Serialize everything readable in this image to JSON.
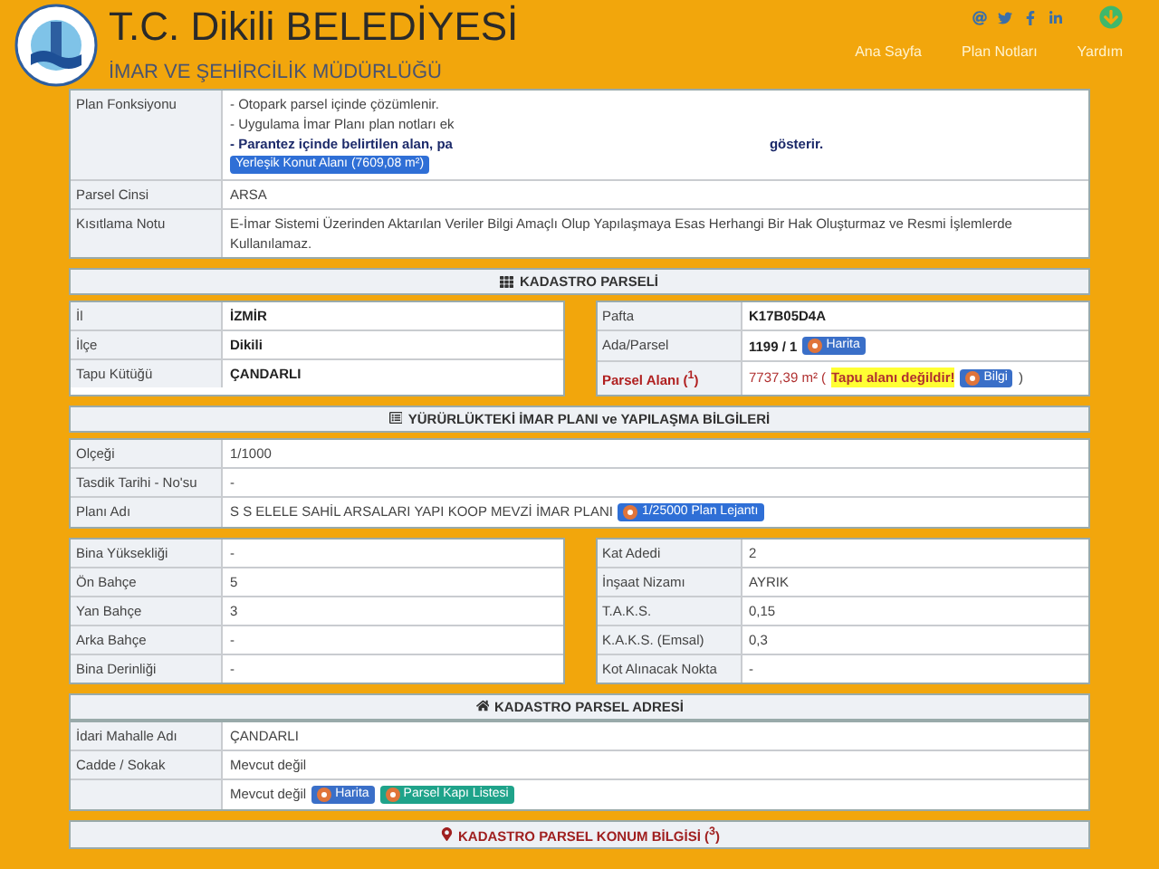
{
  "header": {
    "title": "T.C. Dikili BELEDİYESİ",
    "subtitle": "İMAR VE ŞEHİRCİLİK MÜDÜRLÜĞÜ",
    "nav": [
      "Ana Sayfa",
      "Plan Notları",
      "Yardım"
    ]
  },
  "top_rows": [
    {
      "label": "Plan Fonksiyonu",
      "parts": [
        {
          "kind": "line",
          "text": "- Otopark parsel içinde çözümlenir."
        },
        {
          "kind": "line",
          "text": "- Uygulama İmar Planı plan notları ek"
        },
        {
          "kind": "boldline",
          "text": "- Parantez içinde belirtilen alan, pa",
          "tail": "gösterir."
        },
        {
          "kind": "badge",
          "text": "Yerleşik Konut Alanı (7609,08 m²)",
          "color": "#2f6fd6",
          "icon": false
        }
      ]
    },
    {
      "label": "Parsel Cinsi",
      "parts": [
        {
          "kind": "text",
          "text": "ARSA"
        }
      ]
    },
    {
      "label": "Kısıtlama Notu",
      "parts": [
        {
          "kind": "text",
          "text": "E-İmar Sistemi Üzerinden Aktarılan Veriler Bilgi Amaçlı Olup Yapılaşmaya Esas Herhangi Bir Hak Oluşturmaz ve Resmi İşlemlerde Kullanılamaz."
        }
      ]
    }
  ],
  "kadastro": {
    "title": "KADASTRO PARSELİ",
    "left": [
      {
        "label": "İl",
        "alert": false,
        "parts": [
          {
            "kind": "strong",
            "text": "İZMİR"
          }
        ]
      },
      {
        "label": "İlçe",
        "alert": false,
        "parts": [
          {
            "kind": "strong",
            "text": "Dikili"
          }
        ]
      },
      {
        "label": "Tapu Kütüğü",
        "alert": false,
        "parts": [
          {
            "kind": "strong",
            "text": "ÇANDARLI"
          }
        ]
      }
    ],
    "right": [
      {
        "label": "Pafta",
        "alert": false,
        "parts": [
          {
            "kind": "strong",
            "text": "K17B05D4A"
          }
        ]
      },
      {
        "label": "Ada/Parsel",
        "alert": false,
        "parts": [
          {
            "kind": "strong",
            "text": "1199 / 1"
          },
          {
            "kind": "badge",
            "text": "Harita",
            "color": "#3a6fc8",
            "icon": true
          }
        ]
      },
      {
        "label": "Parsel Alanı ($^{1}$)",
        "alert": true,
        "parts": [
          {
            "kind": "alert",
            "text": "7737,39 m² ("
          },
          {
            "kind": "highlight",
            "text": "Tapu alanı değildir!"
          },
          {
            "kind": "badge",
            "text": "Bilgi",
            "color": "#3a6fc8",
            "icon": true
          },
          {
            "kind": "text",
            "text": ")"
          }
        ]
      }
    ]
  },
  "imar": {
    "title": "YÜRÜRLÜKTEKİ İMAR PLANI ve YAPILAŞMA BİLGİLERİ",
    "rows": [
      {
        "label": "Olçeği",
        "parts": [
          {
            "kind": "text",
            "text": "1/1000"
          }
        ]
      },
      {
        "label": "Tasdik Tarihi - No'su",
        "parts": [
          {
            "kind": "text",
            "text": "-"
          }
        ]
      },
      {
        "label": "Planı Adı",
        "parts": [
          {
            "kind": "text",
            "text": "S S ELELE SAHİL ARSALARI YAPI KOOP MEVZİ İMAR PLANI"
          },
          {
            "kind": "badge",
            "text": "1/25000 Plan Lejantı",
            "color": "#2f6fd6",
            "icon": true
          }
        ]
      }
    ],
    "left": [
      {
        "label": "Bina Yüksekliği",
        "parts": [
          {
            "kind": "text",
            "text": "-"
          }
        ]
      },
      {
        "label": "Ön Bahçe",
        "parts": [
          {
            "kind": "text",
            "text": "5"
          }
        ]
      },
      {
        "label": "Yan Bahçe",
        "parts": [
          {
            "kind": "text",
            "text": "3"
          }
        ]
      },
      {
        "label": "Arka Bahçe",
        "parts": [
          {
            "kind": "text",
            "text": "-"
          }
        ]
      },
      {
        "label": "Bina Derinliği",
        "parts": [
          {
            "kind": "text",
            "text": "-"
          }
        ]
      }
    ],
    "right": [
      {
        "label": "Kat Adedi",
        "parts": [
          {
            "kind": "text",
            "text": "2"
          }
        ]
      },
      {
        "label": "İnşaat Nizamı",
        "parts": [
          {
            "kind": "text",
            "text": "AYRIK"
          }
        ]
      },
      {
        "label": "T.A.K.S.",
        "parts": [
          {
            "kind": "text",
            "text": "0,15"
          }
        ]
      },
      {
        "label": "K.A.K.S. (Emsal)",
        "parts": [
          {
            "kind": "text",
            "text": "0,3"
          }
        ]
      },
      {
        "label": "Kot Alınacak Nokta",
        "parts": [
          {
            "kind": "text",
            "text": "-"
          }
        ]
      }
    ]
  },
  "adres": {
    "title": "KADASTRO PARSEL ADRESİ",
    "rows": [
      {
        "label": "İdari Mahalle Adı",
        "parts": [
          {
            "kind": "text",
            "text": "ÇANDARLI"
          }
        ]
      },
      {
        "label": "Cadde / Sokak",
        "parts": [
          {
            "kind": "text",
            "text": "Mevcut değil"
          }
        ]
      },
      {
        "label": "",
        "parts": [
          {
            "kind": "text",
            "text": "Mevcut değil"
          },
          {
            "kind": "badge",
            "text": "Harita",
            "color": "#3a6fc8",
            "icon": true
          },
          {
            "kind": "badge",
            "text": "Parsel Kapı Listesi",
            "color": "#1fa38a",
            "icon": true
          }
        ]
      }
    ]
  },
  "konum": {
    "title": "KADASTRO PARSEL KONUM BİLGİSİ ($^{3}$)"
  }
}
